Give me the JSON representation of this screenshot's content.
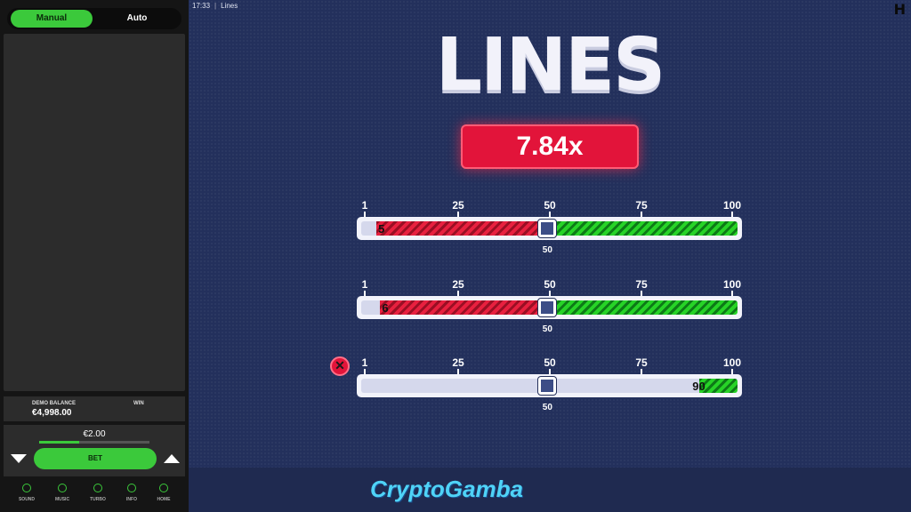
{
  "sidebar": {
    "tabs": [
      {
        "label": "Manual",
        "active": true
      },
      {
        "label": "Auto",
        "active": false
      }
    ],
    "balance": {
      "label": "DEMO BALANCE",
      "value": "€4,998.00"
    },
    "win": {
      "label": "WIN"
    },
    "bet": {
      "amount": "€2.00",
      "button_label": "BET"
    },
    "nav": [
      {
        "label": "SOUND",
        "icon": "sound-icon"
      },
      {
        "label": "MUSIC",
        "icon": "music-icon"
      },
      {
        "label": "TURBO",
        "icon": "turbo-icon"
      },
      {
        "label": "INFO",
        "icon": "info-icon"
      },
      {
        "label": "HOME",
        "icon": "home-icon"
      }
    ]
  },
  "topbar": {
    "time": "17:33",
    "title": "Lines"
  },
  "game": {
    "title": "LINES",
    "multiplier": "7.84x",
    "scale_ticks": [
      "1",
      "25",
      "50",
      "75",
      "100"
    ],
    "lines": [
      {
        "min": 1,
        "max": 100,
        "handle": 50,
        "handle_label": "50",
        "marker": "5",
        "marker_value": 5,
        "red_from": 5,
        "red_to": 50,
        "green_from": 50,
        "green_to": 100,
        "removable": false
      },
      {
        "min": 1,
        "max": 100,
        "handle": 50,
        "handle_label": "50",
        "marker": "6",
        "marker_value": 6,
        "red_from": 6,
        "red_to": 50,
        "green_from": 50,
        "green_to": 100,
        "removable": false
      },
      {
        "min": 1,
        "max": 100,
        "handle": 50,
        "handle_label": "50",
        "marker": "90",
        "marker_value": 90,
        "red_from": null,
        "red_to": null,
        "green_from": 90,
        "green_to": 100,
        "removable": true
      }
    ]
  },
  "watermark": "CryptoGamba",
  "colors": {
    "accent_green": "#3bc93b",
    "danger_red": "#e2143a",
    "background": "#23305c"
  }
}
